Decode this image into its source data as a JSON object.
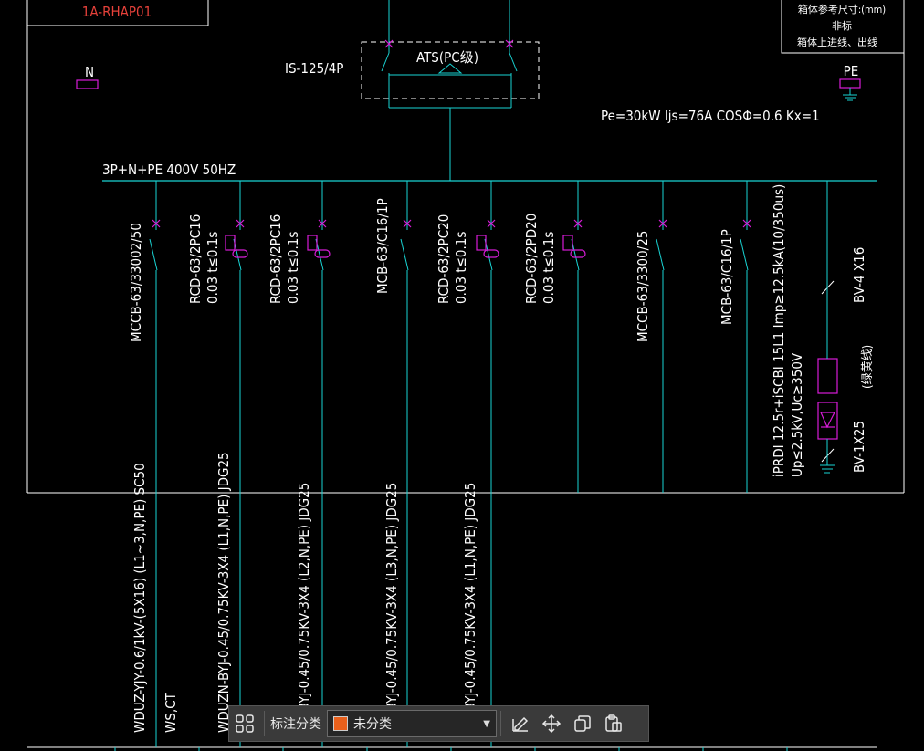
{
  "panel": {
    "id": "1A-RHAP01"
  },
  "top_right_note": [
    "箱体参考尺寸:(mm)",
    "非标",
    "箱体上进线、出线"
  ],
  "left_terminal": "N",
  "right_terminal": "PE",
  "isolator": "IS-125/4P",
  "ats": "ATS(PC级)",
  "load_info": "Pe=30kW  Ijs=76A  COSΦ=0.6  Kx=1",
  "bus_label": "3P+N+PE  400V 50HZ",
  "breakers": [
    {
      "l1": "MCCB-63/33002/50",
      "l2": ""
    },
    {
      "l1": "RCD-63/2PC16",
      "l2": "0.03  t≤0.1s"
    },
    {
      "l1": "RCD-63/2PC16",
      "l2": "0.03  t≤0.1s"
    },
    {
      "l1": "MCB-63/C16/1P",
      "l2": ""
    },
    {
      "l1": "RCD-63/2PC20",
      "l2": "0.03  t≤0.1s"
    },
    {
      "l1": "RCD-63/2PD20",
      "l2": "0.03  t≤0.1s"
    },
    {
      "l1": "MCCB-63/3300/25",
      "l2": ""
    },
    {
      "l1": "MCB-63/C16/1P",
      "l2": ""
    }
  ],
  "spd": {
    "line1": "iPRDI 12.5r+iSCBI 15L1 Imp≥12.5kA(10/350us)",
    "line2": "Up≤2.5kV,Uc≥350V",
    "wire_top": "BV-4 X16",
    "wire_bottom": "BV-1X25",
    "note": "(绿黄线)"
  },
  "cables": [
    {
      "l1": "WDUZ-YJY-0.6/1kV-(5X16) (L1~3,N,PE)  SC50",
      "l2": "WS,CT"
    },
    {
      "l1": "WDUZN-BYJ-0.45/0.75KV-3X4  (L1,N,PE)  JDG25",
      "l2": ""
    },
    {
      "l1": "ZN-BYJ-0.45/0.75KV-3X4  (L2,N,PE)  JDG25",
      "l2": ""
    },
    {
      "l1": "ZN-BYJ-0.45/0.75KV-3X4  (L3,N,PE)  JDG25",
      "l2": ""
    },
    {
      "l1": "ZN-BYJ-0.45/0.75KV-3X4  (L1,N,PE)  JDG25",
      "l2": ""
    }
  ],
  "toolbar": {
    "label": "标注分类",
    "select_value": "未分类",
    "swatch_color": "#e8601c"
  }
}
